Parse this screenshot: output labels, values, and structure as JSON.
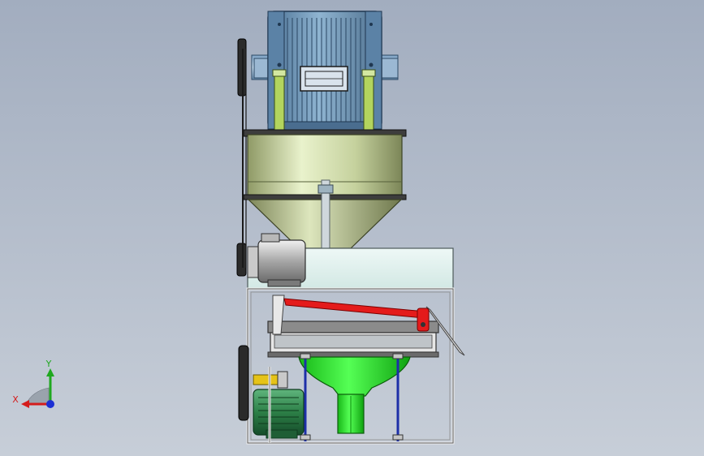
{
  "viewport": {
    "background_top": "#a2adbf",
    "background_bottom": "#c7ced8"
  },
  "triad": {
    "x_label": "X",
    "y_label": "Y",
    "x_color": "#d41c1c",
    "y_color": "#1fa81f",
    "z_color": "#1c2fd4"
  },
  "parts": {
    "top_motor": "drum-motor",
    "hopper": "cylinder-hopper",
    "small_motor": "small-motor",
    "frame": "steel-frame",
    "lever": "red-lever",
    "screen": "vibrating-screen",
    "funnel": "green-funnel",
    "bottom_motor": "green-motor",
    "belt_drive": "pulley-belt"
  },
  "colors": {
    "motor_blue": "#6e95b5",
    "hopper_green": "#c9d9a4",
    "lever_red": "#e01818",
    "funnel_green": "#22e022",
    "motor_green": "#2f8a4c",
    "panel_cyan": "#dff0ee",
    "rod_blue": "#1d2fa8"
  }
}
